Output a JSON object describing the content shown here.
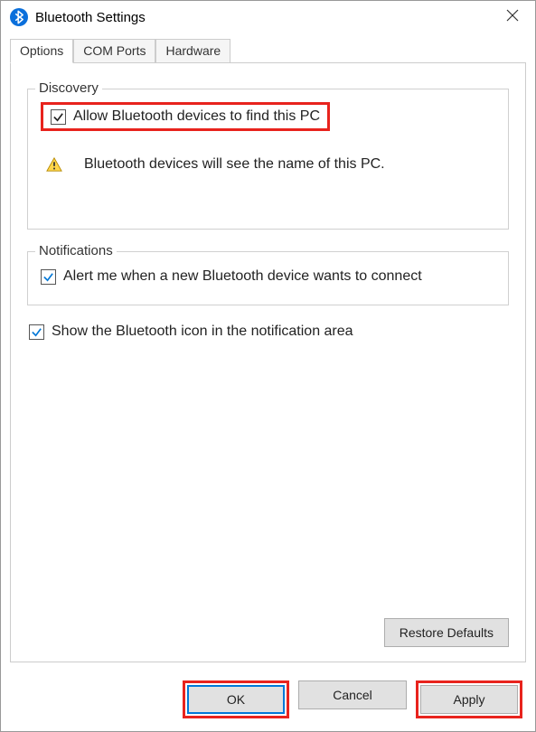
{
  "window": {
    "title": "Bluetooth Settings"
  },
  "tabs": {
    "options": "Options",
    "comports": "COM Ports",
    "hardware": "Hardware"
  },
  "discovery": {
    "legend": "Discovery",
    "allow_label": "Allow Bluetooth devices to find this PC",
    "info": "Bluetooth devices will see the name of this PC."
  },
  "notifications": {
    "legend": "Notifications",
    "alert_label": "Alert me when a new Bluetooth device wants to connect"
  },
  "showicon": {
    "label": "Show the Bluetooth icon in the notification area"
  },
  "buttons": {
    "restore": "Restore Defaults",
    "ok": "OK",
    "cancel": "Cancel",
    "apply": "Apply"
  },
  "colors": {
    "highlight": "#e8231d",
    "check_blue": "#0078d7"
  }
}
